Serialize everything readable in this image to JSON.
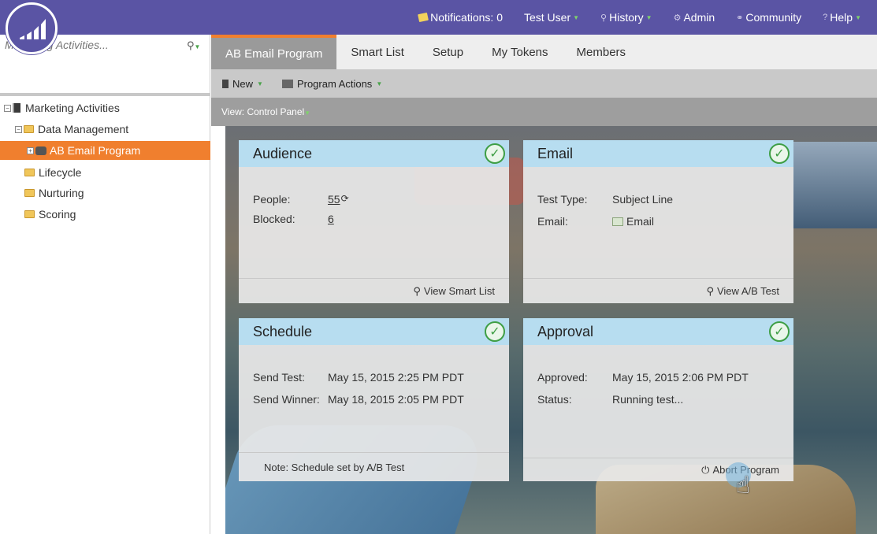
{
  "topnav": {
    "notifications": "Notifications: 0",
    "user": "Test User",
    "history": "History",
    "admin": "Admin",
    "community": "Community",
    "help": "Help"
  },
  "sidebar": {
    "search_placeholder": "Marketing Activities...",
    "tree": [
      {
        "label": "Marketing Activities"
      },
      {
        "label": "Data Management"
      },
      {
        "label": "AB Email Program"
      },
      {
        "label": "Lifecycle"
      },
      {
        "label": "Nurturing"
      },
      {
        "label": "Scoring"
      }
    ]
  },
  "tabs": [
    {
      "label": "AB Email Program"
    },
    {
      "label": "Smart List"
    },
    {
      "label": "Setup"
    },
    {
      "label": "My Tokens"
    },
    {
      "label": "Members"
    }
  ],
  "toolbar": {
    "new": "New",
    "program_actions": "Program Actions"
  },
  "view_label": "View: Control Panel",
  "cards": {
    "audience": {
      "title": "Audience",
      "people_label": "People:",
      "people_value": "55",
      "blocked_label": "Blocked:",
      "blocked_value": "6",
      "footer": "View Smart List"
    },
    "email": {
      "title": "Email",
      "test_type_label": "Test Type:",
      "test_type_value": "Subject Line",
      "email_label": "Email:",
      "email_value": "Email",
      "footer": "View A/B Test"
    },
    "schedule": {
      "title": "Schedule",
      "send_test_label": "Send Test:",
      "send_test_value": "May 15, 2015 2:25 PM PDT",
      "send_winner_label": "Send Winner:",
      "send_winner_value": "May 18, 2015 2:05 PM PDT",
      "footer": "Note: Schedule set by A/B Test"
    },
    "approval": {
      "title": "Approval",
      "approved_label": "Approved:",
      "approved_value": "May 15, 2015 2:06 PM PDT",
      "status_label": "Status:",
      "status_value": "Running test...",
      "footer": "Abort Program"
    }
  },
  "colors": {
    "brand": "#5a54a4",
    "accent": "#f07f2e",
    "card_header": "#b4dcf0",
    "check": "#3e9e45"
  }
}
